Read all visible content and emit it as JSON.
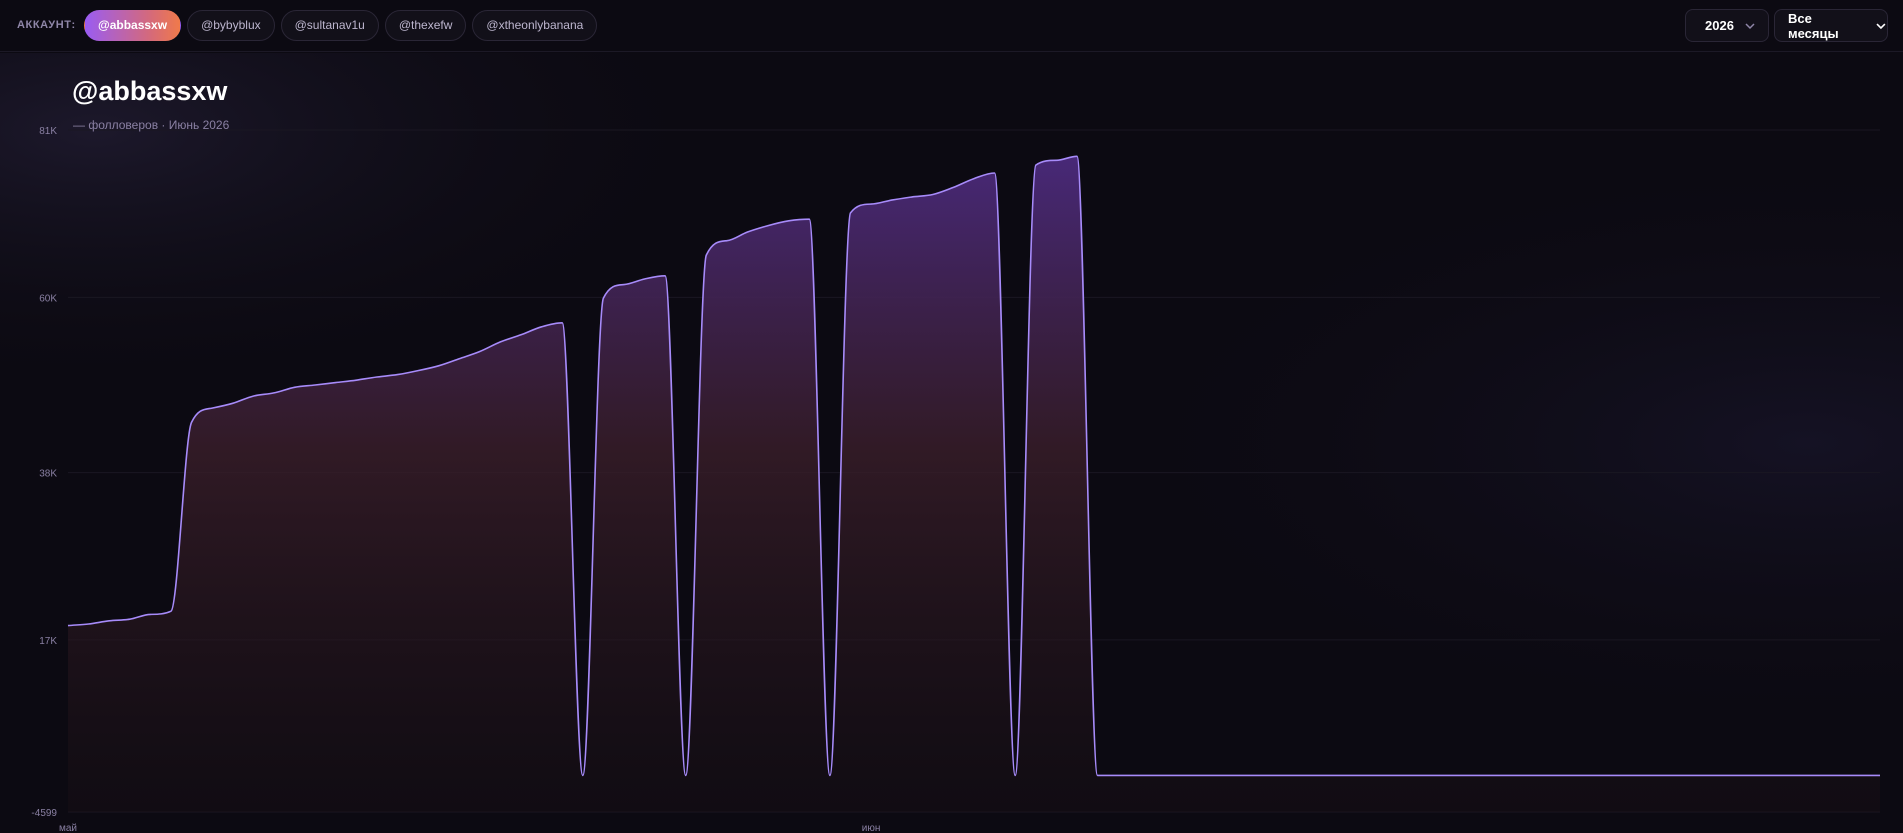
{
  "header": {
    "account_label": "АККАУНТ:",
    "accounts": [
      {
        "label": "@abbassxw",
        "active": true
      },
      {
        "label": "@bybyblux",
        "active": false
      },
      {
        "label": "@sultanav1u",
        "active": false
      },
      {
        "label": "@thexefw",
        "active": false
      },
      {
        "label": "@xtheonlybanana",
        "active": false
      }
    ],
    "year_select": {
      "value": "2026"
    },
    "month_select": {
      "value": "Все месяцы"
    },
    "caret_icon": "chevron-down-icon"
  },
  "chart_header": {
    "title": "@abbassxw",
    "subtitle": "— фолловеров · Июнь 2026"
  },
  "colors": {
    "line": "#a78bfa",
    "fill_top": "#4b2a7d",
    "fill_mid": "#3a1e2a",
    "background": "#0c0a12",
    "grid": "#1a1722",
    "tick_text": "#8a80a3"
  },
  "chart_data": {
    "type": "area",
    "title": "",
    "xlabel": "",
    "ylabel": "",
    "ylim": [
      -4599,
      81000
    ],
    "y_ticks": [
      {
        "value": 81000,
        "label": "81K"
      },
      {
        "value": 60000,
        "label": "60K"
      },
      {
        "value": 38000,
        "label": "38K"
      },
      {
        "value": 17000,
        "label": "17K"
      },
      {
        "value": -4599,
        "label": "-4599"
      }
    ],
    "xlim": [
      0,
      88
    ],
    "x_ticks": [
      {
        "value": 0,
        "label": "май"
      },
      {
        "value": 39,
        "label": "июн"
      }
    ],
    "grid": true,
    "legend": "none",
    "series": [
      {
        "values": [
          [
            0,
            18800
          ],
          [
            1,
            19000
          ],
          [
            2,
            19400
          ],
          [
            3,
            19600
          ],
          [
            4,
            20200
          ],
          [
            5,
            20600
          ],
          [
            6,
            44300
          ],
          [
            7,
            46100
          ],
          [
            8,
            46700
          ],
          [
            9,
            47600
          ],
          [
            10,
            48000
          ],
          [
            11,
            48700
          ],
          [
            12,
            49000
          ],
          [
            13,
            49300
          ],
          [
            14,
            49600
          ],
          [
            15,
            50000
          ],
          [
            16,
            50300
          ],
          [
            17,
            50800
          ],
          [
            18,
            51400
          ],
          [
            19,
            52300
          ],
          [
            20,
            53200
          ],
          [
            21,
            54400
          ],
          [
            22,
            55300
          ],
          [
            23,
            56300
          ],
          [
            24,
            56800
          ],
          [
            25,
            0
          ],
          [
            26,
            59900
          ],
          [
            27,
            61600
          ],
          [
            28,
            62300
          ],
          [
            29,
            62700
          ],
          [
            30,
            0
          ],
          [
            31,
            65300
          ],
          [
            32,
            67100
          ],
          [
            33,
            68200
          ],
          [
            34,
            69000
          ],
          [
            35,
            69600
          ],
          [
            36,
            69800
          ],
          [
            37,
            0
          ],
          [
            38,
            70600
          ],
          [
            39,
            71700
          ],
          [
            40,
            72200
          ],
          [
            41,
            72600
          ],
          [
            42,
            72900
          ],
          [
            43,
            73800
          ],
          [
            44,
            74900
          ],
          [
            45,
            75600
          ],
          [
            46,
            0
          ],
          [
            47,
            76600
          ],
          [
            48,
            77200
          ],
          [
            49,
            77700
          ],
          [
            50,
            0
          ],
          [
            51,
            0
          ],
          [
            88,
            0
          ]
        ]
      }
    ]
  }
}
